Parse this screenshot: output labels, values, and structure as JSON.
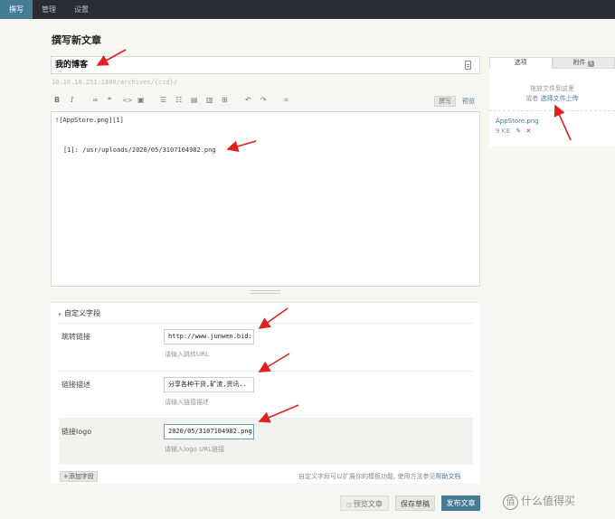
{
  "nav": {
    "items": [
      "撰写",
      "管理",
      "设置"
    ]
  },
  "page": {
    "heading": "撰写新文章"
  },
  "post": {
    "title": "我的博客",
    "permalink": "10.10.10.251:1800/archives/{cid}/",
    "content_lines": [
      "![AppStore.png][1]",
      "[1]: /usr/uploads/2020/05/3107104982.png"
    ]
  },
  "toolbar": {
    "buttons": [
      {
        "name": "bold-icon",
        "glyph": "B"
      },
      {
        "name": "italic-icon",
        "glyph": "I"
      },
      {
        "name": "link-icon",
        "glyph": "∞"
      },
      {
        "name": "quote-icon",
        "glyph": "❝"
      },
      {
        "name": "code-icon",
        "glyph": "<>"
      },
      {
        "name": "image-icon",
        "glyph": "▣"
      },
      {
        "name": "ordered-list-icon",
        "glyph": "☰"
      },
      {
        "name": "bullet-list-icon",
        "glyph": "☷"
      },
      {
        "name": "heading-icon",
        "glyph": "▤"
      },
      {
        "name": "hr-icon",
        "glyph": "▥"
      },
      {
        "name": "more-icon",
        "glyph": "⊞"
      },
      {
        "name": "undo-icon",
        "glyph": "↶"
      },
      {
        "name": "redo-icon",
        "glyph": "↷"
      },
      {
        "name": "fullscreen-icon",
        "glyph": "⌗"
      }
    ],
    "tab_write": "撰写",
    "tab_preview": "预览"
  },
  "custom_fields": {
    "section_label": "自定义字段",
    "rows": [
      {
        "label": "跳转链接",
        "value": "http://www.junwen.bid:",
        "hint": "请输入跳转URL"
      },
      {
        "label": "链接描述",
        "value": "分享各种干货,矿渣,资讯..",
        "hint": "请输入链接描述"
      },
      {
        "label": "链接logo",
        "value": "2020/05/3107104982.png",
        "hint": "请输入logo URL链接"
      }
    ],
    "add_button": "+添加字段",
    "note": "自定义字段可以扩展你的模板功能, 使用方法参见",
    "help_link": "帮助文档"
  },
  "actions": {
    "preview": "预览文章",
    "save_draft": "保存草稿",
    "publish": "发布文章"
  },
  "sidebar": {
    "tab_options": "选项",
    "tab_attachments": "附件",
    "attachment_count": "1",
    "drop_hint": "拖放文件到这里",
    "drop_or": "或者",
    "select_link": "选择文件上传",
    "attachment": {
      "name": "AppStore.png",
      "size": "9 KB"
    }
  },
  "colors": {
    "accent": "#467b96",
    "arrow": "#e02020",
    "nav_bg": "#292d33"
  },
  "watermark": "什么值得买"
}
